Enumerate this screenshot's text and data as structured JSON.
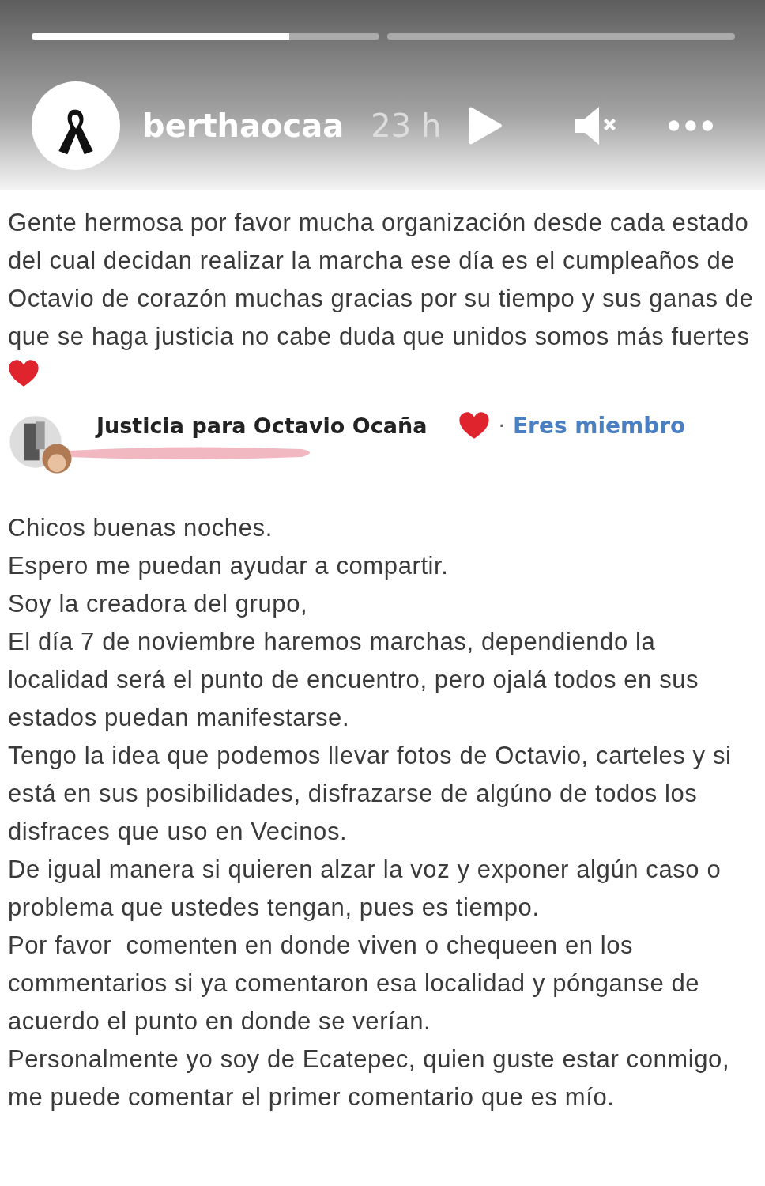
{
  "progress": [
    {
      "level": 0.74
    },
    {
      "level": 0
    }
  ],
  "header": {
    "username": "berthaocaa",
    "time": "23 h",
    "playing": false,
    "muted": true
  },
  "caption": "Gente hermosa por favor mucha organización desde cada estado del cual decidan realizar la marcha ese día es el cumpleaños de Octavio de corazón muchas gracias por su tiempo y sus ganas de que se haga justicia no cabe duda que unidos somos más fuertes",
  "shared_post": {
    "group": "Justicia para Octavio Ocaña",
    "separator": "·",
    "membership": "Eres miembro",
    "paragraphs": [
      "Chicos buenas noches.",
      "Espero me puedan ayudar a compartir.",
      "Soy la creadora del grupo,",
      "El día 7 de noviembre haremos marchas, dependiendo la localidad será el punto de encuentro, pero ojalá todos en sus estados puedan manifestarse.",
      "Tengo la idea que podemos llevar fotos de Octavio, carteles y si está en sus posibilidades, disfrazarse de algúno de todos los disfraces que uso en Vecinos.",
      "De igual manera si quieren alzar la voz y exponer algún caso o problema que ustedes tengan, pues es tiempo.",
      "Por favor  comenten en donde viven o chequeen en los commentarios si ya comentaron esa localidad y pónganse de acuerdo el punto en donde se verían.",
      "Personalmente yo soy de Ecatepec, quien guste estar conmigo, me puede comentar el primer comentario que es mío."
    ]
  }
}
